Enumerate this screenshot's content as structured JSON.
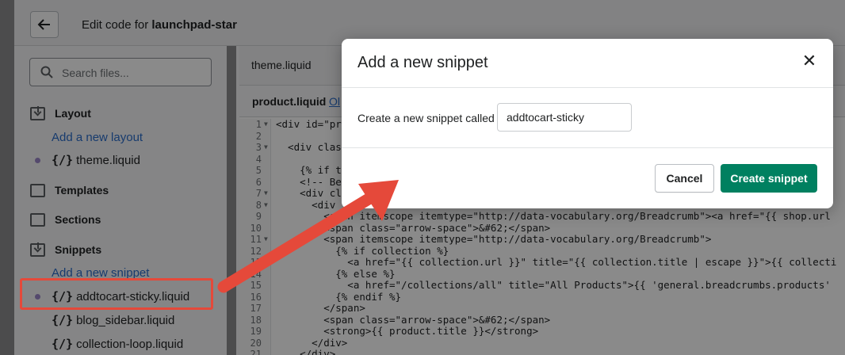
{
  "topbar": {
    "title_prefix": "Edit code for ",
    "theme_name": "launchpad-star"
  },
  "sidebar": {
    "search_placeholder": "Search files...",
    "layout_label": "Layout",
    "add_layout": "Add a new layout",
    "theme_file": "theme.liquid",
    "templates_label": "Templates",
    "sections_label": "Sections",
    "snippets_label": "Snippets",
    "add_snippet": "Add a new snippet",
    "file_glyph": "{/}",
    "snippet_files": [
      "addtocart-sticky.liquid",
      "blog_sidebar.liquid",
      "collection-loop.liquid"
    ]
  },
  "editor": {
    "tab": "theme.liquid",
    "file_name": "product.liquid",
    "older_link": "Ol",
    "line_numbers": [
      "1",
      "2",
      "3",
      "4",
      "5",
      "6",
      "7",
      "8",
      "9",
      "10",
      "11",
      "12",
      "13",
      "14",
      "15",
      "16",
      "17",
      "18",
      "19",
      "20",
      "21"
    ],
    "lines": [
      "<div id=\"pro",
      "",
      "  <div clas",
      "",
      "    {% if t",
      "    <!-- Be",
      "    <div cl",
      "      <div ",
      "        <span itemscope itemtype=\"http://data-vocabulary.org/Breadcrumb\"><a href=\"{{ shop.url",
      "        <span class=\"arrow-space\">&#62;</span>",
      "        <span itemscope itemtype=\"http://data-vocabulary.org/Breadcrumb\">",
      "          {% if collection %}",
      "            <a href=\"{{ collection.url }}\" title=\"{{ collection.title | escape }}\">{{ collecti",
      "          {% else %}",
      "            <a href=\"/collections/all\" title=\"All Products\">{{ 'general.breadcrumbs.products'",
      "          {% endif %}",
      "        </span>",
      "        <span class=\"arrow-space\">&#62;</span>",
      "        <strong>{{ product.title }}</strong>",
      "      </div>",
      "    </div>"
    ]
  },
  "modal": {
    "title": "Add a new snippet",
    "close_symbol": "✕",
    "field_label": "Create a new snippet called",
    "field_value": "addtocart-sticky",
    "cancel_label": "Cancel",
    "create_label": "Create snippet"
  },
  "colors": {
    "primary": "#008060",
    "link": "#2c6ecb",
    "annotation": "#e5493a"
  }
}
